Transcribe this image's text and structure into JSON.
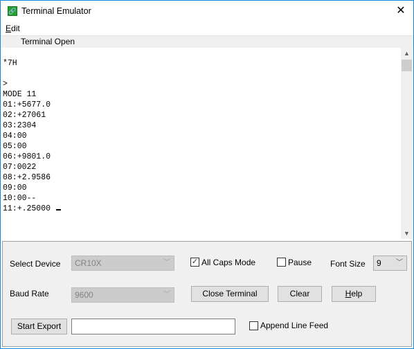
{
  "window": {
    "title": "Terminal Emulator",
    "icon": "link-icon",
    "close_glyph": "✕"
  },
  "menubar": {
    "items": [
      {
        "label": "Edit",
        "mnemonic": "E",
        "rest": "dit"
      }
    ]
  },
  "status": {
    "text": "Terminal Open"
  },
  "terminal": {
    "lines": [
      "",
      "*7H",
      "",
      ">",
      "MODE 11",
      "01:+5677.0",
      "02:+27061",
      "03:2304",
      "04:00",
      "05:00",
      "06:+9801.0",
      "07:0022",
      "08:+2.9586",
      "09:00",
      "10:00--",
      "11:+.25000 "
    ],
    "scroll_up_glyph": "▲",
    "scroll_down_glyph": "▼"
  },
  "controls": {
    "select_device_label": "Select Device",
    "select_device_value": "CR10X",
    "baud_rate_label": "Baud Rate",
    "baud_rate_value": "9600",
    "all_caps_label": "All Caps Mode",
    "all_caps_checked": true,
    "pause_label": "Pause",
    "pause_checked": false,
    "font_size_label": "Font Size",
    "font_size_value": "9",
    "close_terminal_label": "Close Terminal",
    "clear_label": "Clear",
    "help_label": "Help",
    "help_mnemonic": "H",
    "help_rest": "elp",
    "start_export_label": "Start Export",
    "export_path_value": "",
    "append_line_feed_label": "Append Line Feed",
    "append_line_feed_checked": false,
    "dropdown_arrow": "﹀",
    "check_glyph": "✓"
  }
}
